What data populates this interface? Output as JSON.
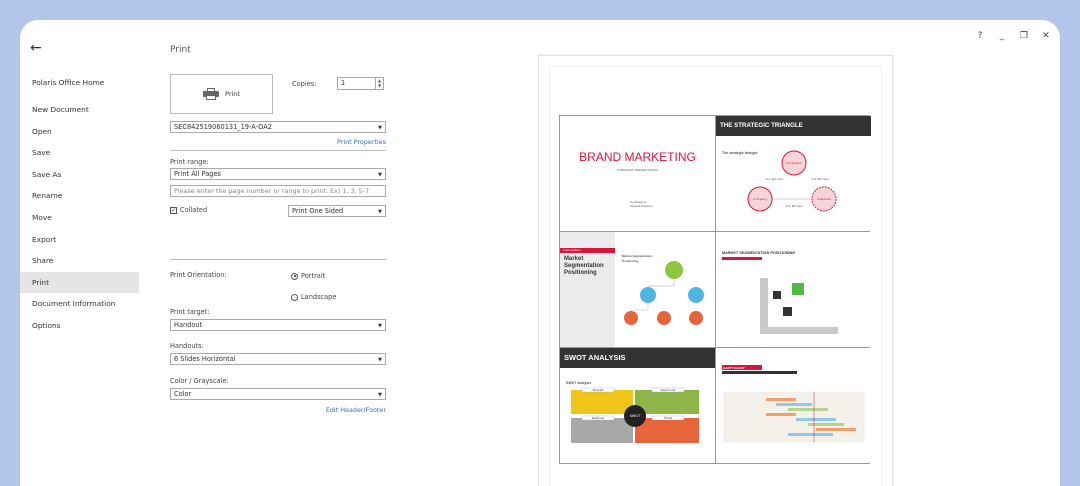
{
  "window": {
    "help": "?",
    "minimize": "_",
    "restore": "❐",
    "close": "✕"
  },
  "nav": {
    "back": "←",
    "items": [
      "Polaris Office Home",
      "New Document",
      "Open",
      "Save",
      "Save As",
      "Rename",
      "Move",
      "Export",
      "Share",
      "Print",
      "Document Information",
      "Options"
    ],
    "active": "Print"
  },
  "print": {
    "title": "Print",
    "button_label": "Print",
    "copies_label": "Copies:",
    "copies_value": "1",
    "printer": "SEC842519060131_19-A-OA2",
    "printer_properties": "Print Properties",
    "range_label": "Print range:",
    "range_value": "Print All Pages",
    "range_placeholder": "Please enter the page number or range to print. Ex) 1, 3, 5-7",
    "collated": "Collated",
    "sided": "Print One Sided",
    "orientation_label": "Print Orientation:",
    "portrait": "Portrait",
    "landscape": "Landscape",
    "target_label": "Print target:",
    "target_value": "Handout",
    "handouts_label": "Handouts:",
    "handouts_value": "6 Slides Horizontal",
    "color_label": "Color / Grayscale:",
    "color_value": "Color",
    "edit_header_footer": "Edit Header/Footer"
  },
  "preview": {
    "slides": [
      {
        "title": "BRAND MARKETING",
        "subtitle": "STRATEGIC PRESENTATION",
        "footer": "Contributors\nPresent Handout"
      },
      {
        "title": "THE STRATEGIC TRIANGLE",
        "bullet": "The strategic triangle.",
        "nodes": [
          "Competitor",
          "Company",
          "Your Text here",
          "Your Text here",
          "Customer",
          "Your Text here"
        ]
      },
      {
        "tag": "Lorem Ipsum",
        "title": "Market Segmentation Positioning",
        "bullets": [
          "Market Segmentation",
          "Positioning"
        ]
      },
      {
        "title": "MARKET SEGMENTATION POSITIONING"
      },
      {
        "title": "SWOT ANALYSIS",
        "bullet": "SWOT analysis",
        "quadrants": [
          "Strength",
          "Opportunity",
          "Weakness",
          "Threat"
        ],
        "center": "SWOT"
      },
      {
        "title": "GANTT CHART"
      }
    ]
  },
  "colors": {
    "accent": "#2c6fcf",
    "brand_red": "#d8163c",
    "frame": "#b3c5ea"
  }
}
